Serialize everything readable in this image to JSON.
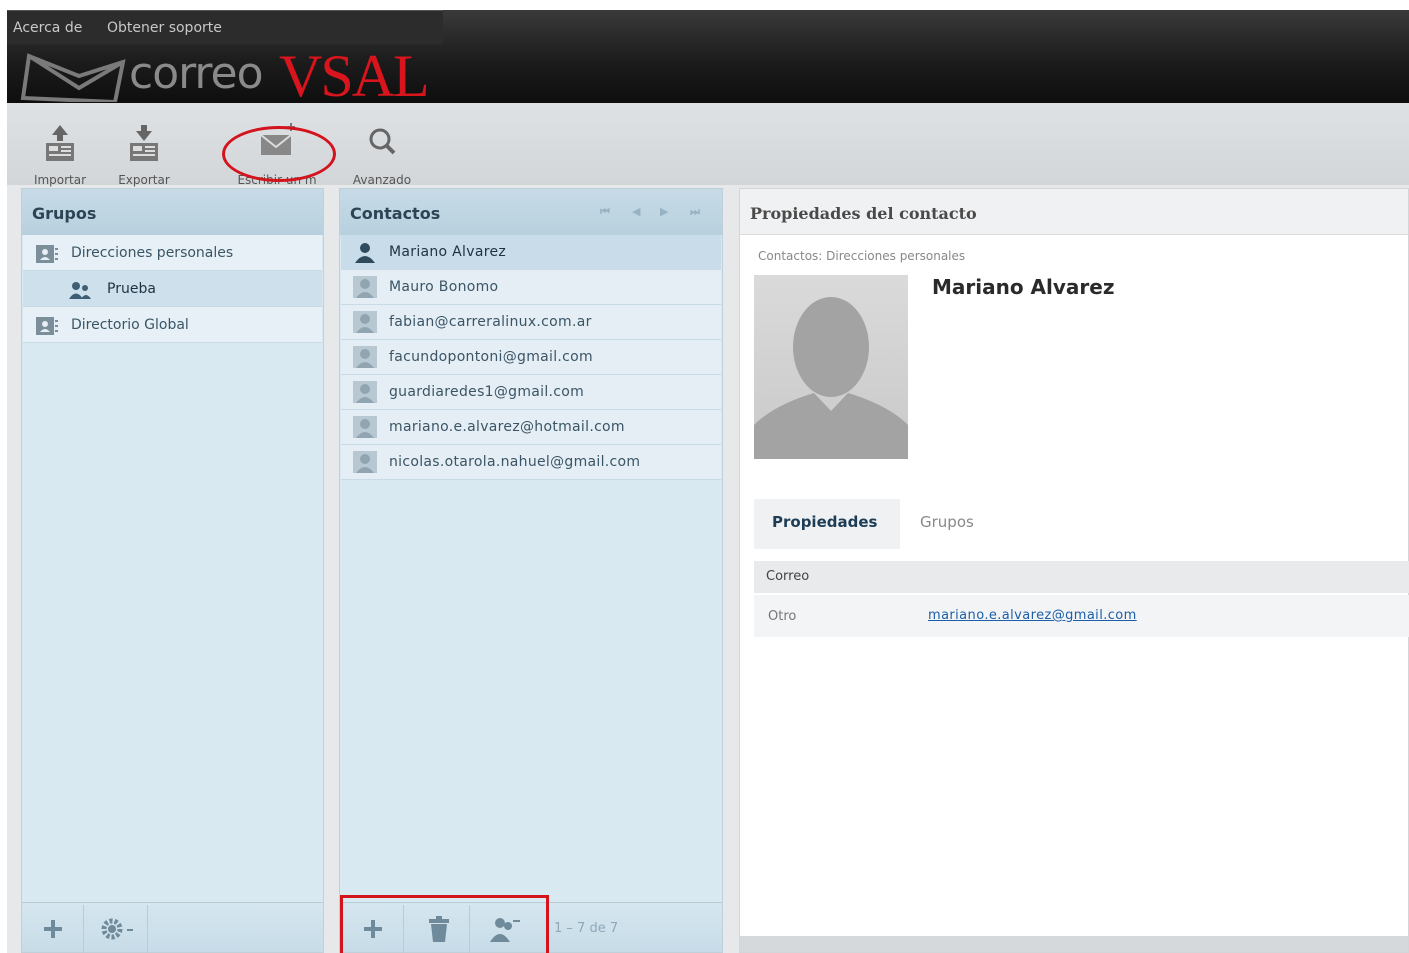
{
  "topbar": {
    "about": "Acerca de",
    "support": "Obtener soporte"
  },
  "logo": {
    "part1": "correo",
    "part2": "VSAL"
  },
  "toolbar": {
    "import": "Importar",
    "export": "Exportar",
    "compose": "Escribir un m",
    "advanced": "Avanzado"
  },
  "groups": {
    "title": "Grupos",
    "items": [
      {
        "label": "Direcciones personales",
        "icon": "addressbook-icon"
      },
      {
        "label": "Prueba",
        "icon": "group-icon"
      },
      {
        "label": "Directorio Global",
        "icon": "addressbook-icon"
      }
    ]
  },
  "contacts": {
    "title": "Contactos",
    "items": [
      "Mariano Alvarez",
      "Mauro Bonomo",
      "fabian@carreralinux.com.ar",
      "facundopontoni@gmail.com",
      "guardiaredes1@gmail.com",
      "mariano.e.alvarez@hotmail.com",
      "nicolas.otarola.nahuel@gmail.com"
    ],
    "count": "1 – 7 de 7"
  },
  "details": {
    "title": "Propiedades del contacto",
    "breadcrumb": "Contactos: Direcciones personales",
    "name": "Mariano Alvarez",
    "tab_properties": "Propiedades",
    "tab_groups": "Grupos",
    "section": "Correo",
    "field_label": "Otro",
    "field_value": "mariano.e.alvarez@gmail.com"
  },
  "colors": {
    "accent_red": "#d3141c",
    "link": "#1c5fa8",
    "panel": "#d9e9f2"
  }
}
